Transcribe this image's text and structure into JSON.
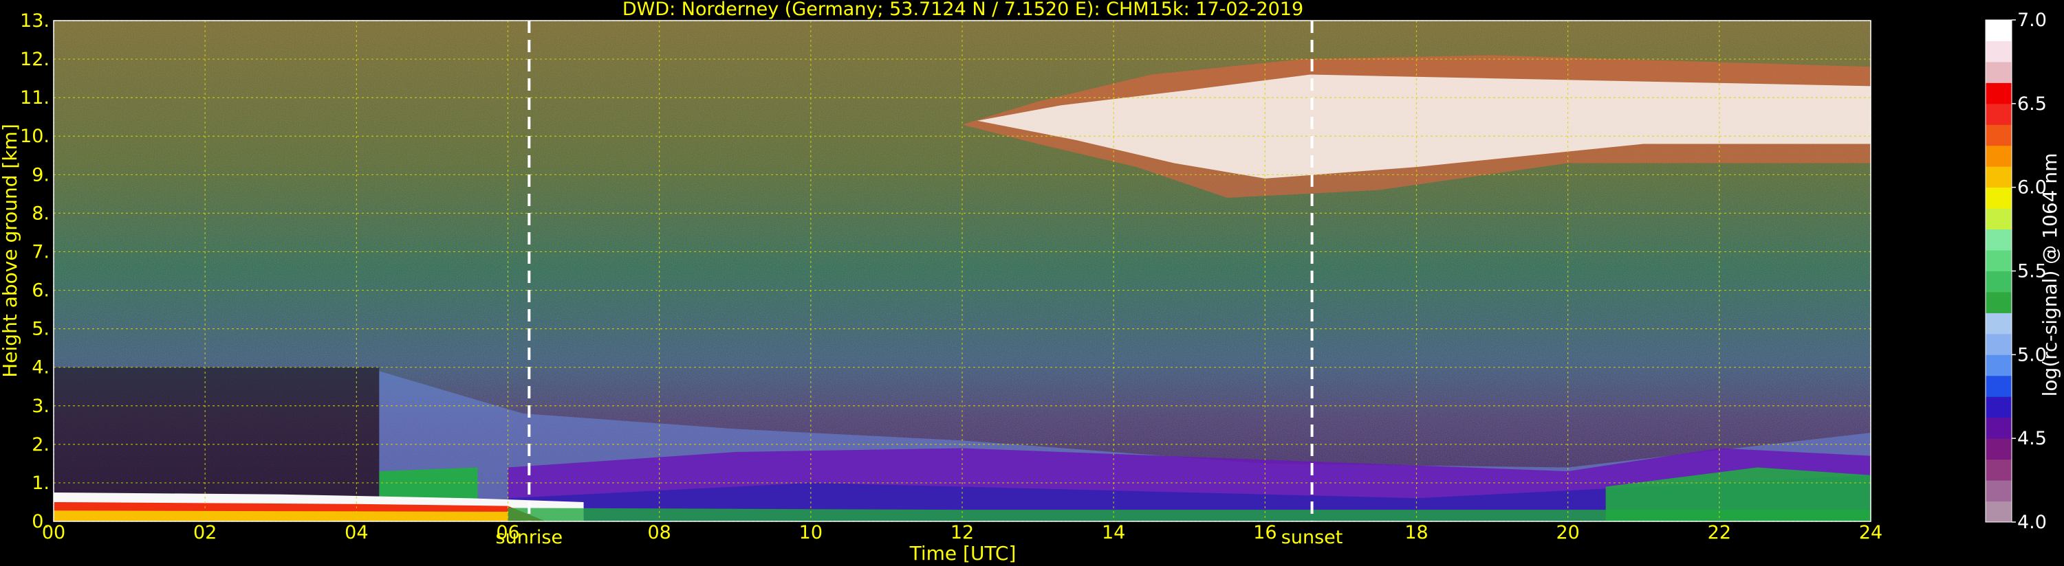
{
  "chart_data": {
    "type": "heatmap",
    "title": "DWD: Norderney (Germany; 53.7124 N / 7.1520 E):    CHM15k: 17-02-2019",
    "xlabel": "Time [UTC]",
    "ylabel": "Height above ground [km]",
    "xlim": [
      0,
      24
    ],
    "ylim": [
      0,
      13
    ],
    "x_ticks": [
      "00",
      "02",
      "04",
      "06",
      "08",
      "10",
      "12",
      "14",
      "16",
      "18",
      "20",
      "22",
      "24"
    ],
    "y_ticks": [
      "0.",
      "1.",
      "2.",
      "3.",
      "4.",
      "5.",
      "6.",
      "7.",
      "8.",
      "9.",
      "10.",
      "11.",
      "12.",
      "13."
    ],
    "grid": true,
    "colorbar": {
      "label": "log(rc-signal) @ 1064 nm",
      "ticks": [
        "4.0",
        "4.5",
        "5.0",
        "5.5",
        "6.0",
        "6.5",
        "7.0"
      ],
      "range": [
        4.0,
        7.0
      ],
      "colors": [
        "#b090a8",
        "#a06898",
        "#903880",
        "#7a1a80",
        "#6010a0",
        "#3018c0",
        "#2050e8",
        "#5a90f0",
        "#8ab0f0",
        "#a8c8f0",
        "#30a840",
        "#40c060",
        "#60d880",
        "#80e8a0",
        "#c8f040",
        "#f0f000",
        "#f8c000",
        "#f89000",
        "#f05818",
        "#f02820",
        "#f00000",
        "#e8b8c0",
        "#f8e0e8",
        "#ffffff"
      ]
    },
    "markers": [
      {
        "label": "sunrise",
        "x": 6.28
      },
      {
        "label": "sunset",
        "x": 16.62
      }
    ],
    "features": [
      {
        "name": "surface aerosol layer",
        "x_range": [
          0,
          24
        ],
        "height_km": [
          0,
          1.8
        ]
      },
      {
        "name": "cirrus cloud",
        "x_range": [
          12,
          24
        ],
        "height_km": [
          8.5,
          12.5
        ]
      }
    ]
  }
}
